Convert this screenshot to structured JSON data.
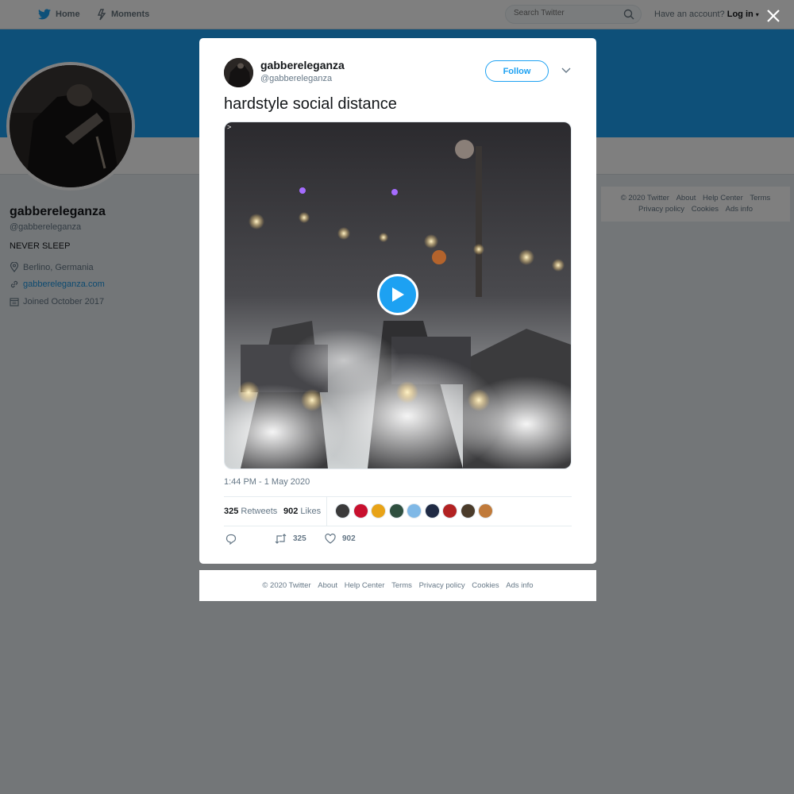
{
  "nav": {
    "home_label": "Home",
    "moments_label": "Moments",
    "search_placeholder": "Search Twitter",
    "account_prompt": "Have an account?",
    "login_label": "Log in"
  },
  "profile": {
    "name": "gabbereleganza",
    "handle": "@gabbereleganza",
    "bio": "NEVER SLEEP",
    "location": "Berlino, Germania",
    "website": "gabbereleganza.com",
    "joined": "Joined October 2017"
  },
  "side_footer": [
    "© 2020 Twitter",
    "About",
    "Help Center",
    "Terms",
    "Privacy policy",
    "Cookies",
    "Ads info"
  ],
  "tweet": {
    "author_name": "gabbereleganza",
    "author_handle": "@gabbereleganza",
    "follow_label": "Follow",
    "text": "hardstyle social distance",
    "media_tag": ">",
    "timestamp": "1:44 PM - 1 May 2020",
    "retweet_count": "325",
    "retweets_label": "Retweets",
    "like_count": "902",
    "likes_label": "Likes",
    "action_retweet_count": "325",
    "action_like_count": "902"
  },
  "likers": [
    "#3a3a3a",
    "#c8102e",
    "#e8a317",
    "#2f4f3f",
    "#7fb8e6",
    "#1f2a44",
    "#b22222",
    "#4a3b2a",
    "#c07a3a"
  ],
  "modal_footer": [
    "© 2020 Twitter",
    "About",
    "Help Center",
    "Terms",
    "Privacy policy",
    "Cookies",
    "Ads info"
  ],
  "colors": {
    "accent": "#1da1f2",
    "banner": "#1da1f2",
    "overlay": "rgba(0,0,0,0.5)"
  }
}
